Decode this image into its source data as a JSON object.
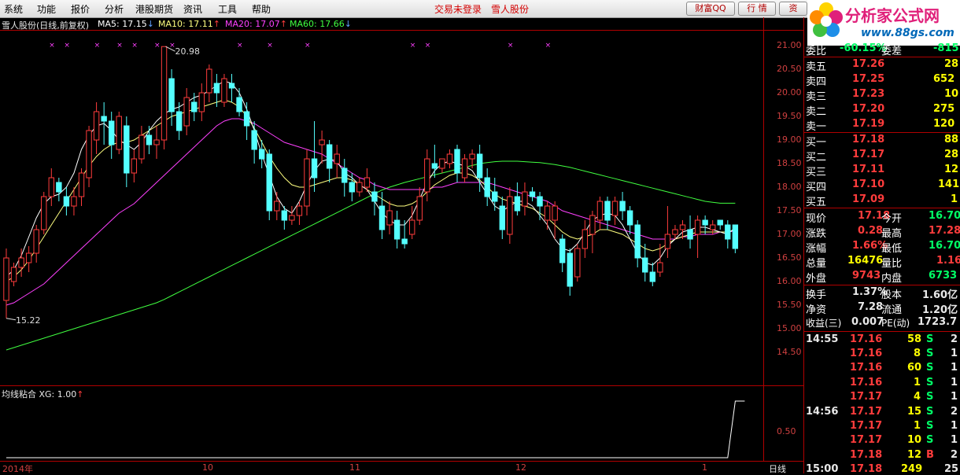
{
  "menu": [
    "系统",
    "功能",
    "报价",
    "分析",
    "港股期货",
    "资讯",
    "工具",
    "帮助"
  ],
  "status_text": "交易未登录",
  "stock_name_title": "雪人股份",
  "toolbar": {
    "caifu": "财富QQ",
    "hangqing": "行 情",
    "zi": "资"
  },
  "logo": {
    "title": "分析家公式网",
    "url": "www.88gs.com"
  },
  "chart": {
    "title": "雪人股份(日线,前复权)",
    "ma": [
      {
        "label": "MA5: 17.15",
        "arrow": "↓",
        "color": "#ffffff"
      },
      {
        "label": "MA10: 17.11",
        "arrow": "↑",
        "color": "#ffff80"
      },
      {
        "label": "MA20: 17.07",
        "arrow": "↑",
        "color": "#ff40ff"
      },
      {
        "label": "MA60: 17.66",
        "arrow": "↓",
        "color": "#40ff40"
      }
    ],
    "price_labels": [
      "21.00",
      "20.50",
      "20.00",
      "19.50",
      "19.00",
      "18.50",
      "18.00",
      "17.50",
      "17.00",
      "16.50",
      "16.00",
      "15.50",
      "15.00",
      "14.50"
    ],
    "high_label": "20.98",
    "low_label": "15.22",
    "indicator": {
      "name": "均线粘合",
      "value_label": "XG: 1.00",
      "arrow": "↑",
      "axis_label": "0.50"
    },
    "date_labels": [
      {
        "text": "2014年"
      },
      {
        "text": "10"
      },
      {
        "text": "11"
      },
      {
        "text": "12"
      },
      {
        "text": "1"
      }
    ],
    "period": "日线",
    "colors": {
      "up": "#ff3c3c",
      "down": "#54ffff",
      "ma5": "#ffffff",
      "ma10": "#ffff80",
      "ma20": "#ff40ff",
      "ma60": "#40ff40",
      "grid": "#b00000"
    }
  },
  "chart_data": {
    "type": "candlestick",
    "ylim": [
      14.5,
      21.0
    ],
    "candles": [
      [
        15.6,
        16.5,
        15.22,
        16.7
      ],
      [
        16.0,
        16.3,
        15.9,
        16.4
      ],
      [
        16.3,
        16.5,
        16.1,
        16.7
      ],
      [
        16.4,
        16.6,
        16.2,
        16.75
      ],
      [
        16.6,
        17.1,
        16.4,
        17.2
      ],
      [
        17.1,
        17.8,
        17.0,
        17.9
      ],
      [
        17.8,
        18.2,
        17.6,
        18.4
      ],
      [
        18.1,
        17.9,
        17.7,
        18.2
      ],
      [
        17.8,
        17.6,
        17.4,
        18.0
      ],
      [
        17.6,
        17.8,
        17.4,
        18.0
      ],
      [
        17.8,
        18.3,
        17.6,
        18.4
      ],
      [
        18.2,
        19.2,
        18.0,
        19.3
      ],
      [
        19.0,
        19.6,
        18.7,
        19.8
      ],
      [
        19.5,
        19.4,
        18.9,
        19.8
      ],
      [
        19.4,
        18.9,
        18.6,
        19.6
      ],
      [
        18.8,
        19.5,
        18.7,
        19.6
      ],
      [
        19.3,
        18.3,
        18.0,
        19.5
      ],
      [
        18.3,
        18.6,
        18.1,
        18.8
      ],
      [
        18.6,
        19.1,
        18.5,
        19.3
      ],
      [
        19.1,
        18.9,
        18.7,
        19.3
      ],
      [
        18.9,
        19.0,
        18.6,
        19.3
      ],
      [
        19.0,
        20.98,
        18.8,
        20.98
      ],
      [
        20.3,
        19.6,
        19.3,
        20.5
      ],
      [
        19.6,
        19.2,
        19.0,
        19.8
      ],
      [
        19.3,
        19.9,
        19.1,
        20.1
      ],
      [
        19.8,
        19.6,
        19.4,
        20.0
      ],
      [
        19.6,
        20.0,
        19.4,
        20.2
      ],
      [
        20.0,
        20.5,
        19.8,
        20.6
      ],
      [
        20.2,
        20.0,
        19.7,
        20.4
      ],
      [
        19.8,
        20.3,
        19.7,
        20.4
      ],
      [
        20.2,
        20.1,
        19.8,
        20.4
      ],
      [
        19.9,
        19.6,
        19.5,
        20.1
      ],
      [
        19.6,
        19.3,
        19.0,
        19.8
      ],
      [
        19.2,
        18.8,
        18.5,
        19.4
      ],
      [
        18.8,
        18.6,
        18.4,
        19.0
      ],
      [
        18.7,
        17.5,
        17.3,
        18.8
      ],
      [
        17.5,
        17.7,
        17.3,
        17.9
      ],
      [
        17.5,
        17.3,
        17.1,
        17.6
      ],
      [
        17.3,
        17.4,
        17.2,
        17.6
      ],
      [
        17.4,
        17.6,
        17.2,
        17.7
      ],
      [
        17.6,
        18.6,
        17.4,
        18.8
      ],
      [
        18.6,
        18.2,
        17.9,
        19.4
      ],
      [
        18.9,
        19.0,
        18.5,
        19.2
      ],
      [
        18.9,
        18.4,
        18.1,
        19.0
      ],
      [
        18.5,
        18.7,
        18.2,
        18.9
      ],
      [
        18.4,
        18.1,
        17.8,
        18.6
      ],
      [
        18.1,
        17.9,
        17.7,
        18.3
      ],
      [
        17.9,
        18.1,
        17.8,
        18.2
      ],
      [
        18.0,
        18.2,
        17.9,
        18.4
      ],
      [
        17.9,
        17.7,
        17.4,
        18.1
      ],
      [
        17.6,
        17.1,
        16.9,
        17.9
      ],
      [
        17.2,
        17.5,
        17.0,
        17.7
      ],
      [
        17.3,
        16.9,
        16.7,
        17.5
      ],
      [
        16.9,
        16.8,
        16.7,
        17.3
      ],
      [
        17.0,
        17.3,
        16.9,
        17.6
      ],
      [
        17.3,
        17.8,
        17.2,
        18.0
      ],
      [
        17.9,
        18.6,
        17.7,
        18.8
      ],
      [
        18.5,
        18.4,
        18.2,
        18.9
      ],
      [
        18.4,
        18.6,
        18.3,
        18.6
      ],
      [
        18.5,
        18.7,
        18.4,
        18.8
      ],
      [
        18.8,
        18.3,
        18.1,
        18.9
      ],
      [
        18.2,
        18.6,
        18.1,
        18.7
      ],
      [
        18.6,
        18.7,
        18.4,
        18.8
      ],
      [
        18.7,
        18.2,
        17.9,
        18.9
      ],
      [
        18.2,
        17.8,
        17.6,
        18.4
      ],
      [
        17.9,
        17.7,
        17.5,
        18.2
      ],
      [
        17.6,
        17.1,
        16.9,
        17.8
      ],
      [
        17.0,
        17.8,
        16.8,
        18.0
      ],
      [
        17.8,
        17.5,
        17.4,
        18.1
      ],
      [
        17.6,
        17.9,
        17.4,
        18.1
      ],
      [
        17.9,
        17.8,
        17.7,
        18.0
      ],
      [
        17.8,
        17.6,
        17.3,
        17.9
      ],
      [
        17.3,
        17.6,
        17.1,
        17.7
      ],
      [
        17.3,
        17.6,
        16.9,
        17.7
      ],
      [
        16.9,
        16.4,
        16.2,
        17.0
      ],
      [
        16.6,
        15.9,
        15.7,
        16.7
      ],
      [
        16.1,
        16.7,
        16.0,
        16.8
      ],
      [
        16.7,
        17.1,
        16.5,
        17.3
      ],
      [
        17.0,
        17.4,
        16.6,
        17.5
      ],
      [
        17.3,
        17.7,
        17.1,
        17.8
      ],
      [
        17.7,
        17.3,
        17.1,
        17.8
      ],
      [
        17.4,
        17.7,
        17.2,
        17.8
      ],
      [
        17.7,
        17.5,
        17.3,
        17.9
      ],
      [
        17.5,
        17.2,
        17.0,
        17.6
      ],
      [
        17.2,
        16.5,
        16.3,
        17.3
      ],
      [
        16.5,
        16.2,
        16.0,
        16.8
      ],
      [
        16.2,
        16.0,
        15.9,
        16.4
      ],
      [
        16.2,
        16.4,
        16.1,
        16.8
      ],
      [
        16.7,
        17.0,
        16.5,
        17.6
      ],
      [
        17.0,
        17.1,
        16.9,
        17.2
      ],
      [
        17.1,
        17.2,
        16.9,
        17.3
      ],
      [
        17.1,
        16.9,
        16.7,
        17.4
      ],
      [
        17.0,
        17.3,
        16.5,
        17.4
      ],
      [
        17.3,
        17.2,
        17.0,
        17.4
      ],
      [
        17.1,
        17.2,
        17.0,
        17.3
      ],
      [
        17.3,
        17.2,
        17.1,
        17.3
      ],
      [
        17.2,
        16.9,
        16.7,
        17.3
      ],
      [
        17.2,
        16.7,
        16.6,
        17.2
      ]
    ],
    "ma_lines": {
      "MA5": [
        16.1,
        16.25,
        16.55,
        16.95,
        17.35,
        17.65,
        17.8,
        17.85,
        18.0,
        18.3,
        18.8,
        19.1,
        19.3,
        19.35,
        19.2,
        19.0,
        18.9,
        18.8,
        18.95,
        19.2,
        19.4,
        19.55,
        19.65,
        19.7,
        19.8,
        19.9,
        19.95,
        20.05,
        20.15,
        20.25,
        20.2,
        20.0,
        19.65,
        19.2,
        18.7,
        18.25,
        17.8,
        17.55,
        17.45,
        17.7,
        18.05,
        18.35,
        18.55,
        18.6,
        18.55,
        18.3,
        18.2,
        18.05,
        17.95,
        17.7,
        17.45,
        17.3,
        17.2,
        17.2,
        17.4,
        17.75,
        18.1,
        18.35,
        18.5,
        18.55,
        18.5,
        18.45,
        18.35,
        18.1,
        17.85,
        17.6,
        17.5,
        17.6,
        17.7,
        17.7,
        17.6,
        17.4,
        17.2,
        16.9,
        16.7,
        16.65,
        16.8,
        17.05,
        17.3,
        17.4,
        17.45,
        17.4,
        17.2,
        16.9,
        16.6,
        16.4,
        16.35,
        16.5,
        16.75,
        16.9,
        17.05,
        17.1,
        17.15,
        17.15,
        17.1,
        17.05,
        17.0,
        17.15
      ],
      "MA10": [
        16.0,
        16.1,
        16.25,
        16.45,
        16.7,
        16.95,
        17.2,
        17.45,
        17.7,
        17.95,
        18.2,
        18.45,
        18.65,
        18.8,
        18.9,
        18.95,
        18.95,
        19.0,
        19.1,
        19.2,
        19.3,
        19.4,
        19.5,
        19.55,
        19.6,
        19.65,
        19.7,
        19.75,
        19.8,
        19.85,
        19.8,
        19.7,
        19.5,
        19.25,
        18.95,
        18.65,
        18.4,
        18.2,
        18.05,
        18.0,
        18.0,
        18.05,
        18.1,
        18.15,
        18.2,
        18.2,
        18.15,
        18.05,
        17.95,
        17.85,
        17.75,
        17.65,
        17.6,
        17.6,
        17.65,
        17.75,
        17.9,
        18.05,
        18.15,
        18.25,
        18.3,
        18.3,
        18.25,
        18.15,
        18.0,
        17.85,
        17.75,
        17.7,
        17.65,
        17.6,
        17.55,
        17.45,
        17.35,
        17.2,
        17.05,
        16.95,
        16.9,
        16.95,
        17.0,
        17.1,
        17.1,
        17.05,
        17.0,
        16.9,
        16.8,
        16.7,
        16.65,
        16.7,
        16.8,
        16.9,
        16.95,
        17.0,
        17.05,
        17.05,
        17.05,
        17.05,
        17.05,
        17.1
      ],
      "MA20": [
        15.5,
        15.55,
        15.65,
        15.75,
        15.85,
        15.95,
        16.1,
        16.25,
        16.4,
        16.55,
        16.7,
        16.85,
        17.0,
        17.15,
        17.3,
        17.45,
        17.55,
        17.65,
        17.8,
        17.95,
        18.1,
        18.25,
        18.4,
        18.55,
        18.7,
        18.85,
        19.0,
        19.15,
        19.3,
        19.4,
        19.45,
        19.45,
        19.4,
        19.35,
        19.25,
        19.15,
        19.05,
        18.95,
        18.9,
        18.85,
        18.8,
        18.75,
        18.7,
        18.6,
        18.5,
        18.4,
        18.3,
        18.2,
        18.15,
        18.05,
        18.0,
        17.95,
        17.95,
        17.95,
        17.95,
        17.95,
        17.95,
        18.0,
        18.0,
        18.05,
        18.1,
        18.1,
        18.1,
        18.1,
        18.1,
        18.05,
        18.0,
        17.95,
        17.9,
        17.85,
        17.8,
        17.75,
        17.7,
        17.6,
        17.5,
        17.45,
        17.4,
        17.35,
        17.3,
        17.25,
        17.2,
        17.15,
        17.1,
        17.05,
        17.0,
        16.95,
        16.9,
        16.9,
        16.9,
        16.9,
        16.95,
        16.95,
        17.0,
        17.0,
        17.0,
        17.05,
        17.05,
        17.07
      ],
      "MA60": [
        14.55,
        14.6,
        14.65,
        14.7,
        14.75,
        14.8,
        14.85,
        14.9,
        14.95,
        15.0,
        15.05,
        15.1,
        15.15,
        15.2,
        15.25,
        15.3,
        15.35,
        15.4,
        15.45,
        15.5,
        15.55,
        15.62,
        15.7,
        15.78,
        15.86,
        15.94,
        16.02,
        16.1,
        16.18,
        16.26,
        16.34,
        16.42,
        16.5,
        16.58,
        16.66,
        16.74,
        16.82,
        16.9,
        16.98,
        17.06,
        17.14,
        17.22,
        17.3,
        17.38,
        17.46,
        17.54,
        17.62,
        17.7,
        17.78,
        17.86,
        17.94,
        18.0,
        18.05,
        18.1,
        18.14,
        18.18,
        18.22,
        18.26,
        18.3,
        18.34,
        18.38,
        18.42,
        18.46,
        18.5,
        18.52,
        18.54,
        18.55,
        18.55,
        18.55,
        18.54,
        18.53,
        18.52,
        18.5,
        18.48,
        18.45,
        18.42,
        18.38,
        18.34,
        18.3,
        18.26,
        18.22,
        18.18,
        18.14,
        18.1,
        18.06,
        18.02,
        17.98,
        17.94,
        17.9,
        17.86,
        17.82,
        17.78,
        17.74,
        17.7,
        17.68,
        17.66,
        17.66,
        17.66
      ]
    },
    "indicator_series": [
      0,
      0,
      0,
      0,
      0,
      0,
      0,
      0,
      0,
      0,
      0,
      0,
      0,
      0,
      0,
      0,
      0,
      0,
      0,
      0,
      0,
      0,
      0,
      0,
      0,
      0,
      0,
      0,
      0,
      0,
      0,
      0,
      0,
      0,
      0,
      0,
      0,
      0,
      0,
      0,
      0,
      0,
      0,
      0,
      0,
      0,
      0,
      0,
      0,
      0,
      0,
      0,
      0,
      0,
      0,
      0,
      0,
      0,
      0,
      0,
      0,
      0,
      0,
      0,
      0,
      0,
      0,
      0,
      0,
      0,
      0,
      0,
      0,
      0,
      0,
      0,
      0,
      0,
      0,
      0,
      0,
      0,
      0,
      0,
      0,
      0,
      0,
      0,
      0,
      0,
      0,
      0,
      0,
      0,
      0,
      0,
      0,
      1
    ]
  },
  "quote": {
    "ratio": {
      "label1": "委比",
      "value1": "-60.15%",
      "label2": "委差",
      "value2": "-815"
    },
    "asks": [
      {
        "label": "卖五",
        "price": "17.26",
        "vol": "28"
      },
      {
        "label": "卖四",
        "price": "17.25",
        "vol": "652"
      },
      {
        "label": "卖三",
        "price": "17.23",
        "vol": "10"
      },
      {
        "label": "卖二",
        "price": "17.20",
        "vol": "275"
      },
      {
        "label": "卖一",
        "price": "17.19",
        "vol": "120"
      }
    ],
    "bids": [
      {
        "label": "买一",
        "price": "17.18",
        "vol": "88"
      },
      {
        "label": "买二",
        "price": "17.17",
        "vol": "28"
      },
      {
        "label": "买三",
        "price": "17.11",
        "vol": "12"
      },
      {
        "label": "买四",
        "price": "17.10",
        "vol": "141"
      },
      {
        "label": "买五",
        "price": "17.09",
        "vol": "1"
      }
    ],
    "stats": [
      {
        "l1": "现价",
        "v1": "17.18",
        "c1": "red",
        "l2": "今开",
        "v2": "16.70",
        "c2": "grn"
      },
      {
        "l1": "涨跌",
        "v1": "0.28",
        "c1": "red",
        "l2": "最高",
        "v2": "17.28",
        "c2": "red"
      },
      {
        "l1": "涨幅",
        "v1": "1.66%",
        "c1": "red",
        "l2": "最低",
        "v2": "16.70",
        "c2": "grn"
      },
      {
        "l1": "总量",
        "v1": "16476",
        "c1": "yel",
        "l2": "量比",
        "v2": "1.16",
        "c2": "red"
      },
      {
        "l1": "外盘",
        "v1": "9743",
        "c1": "red",
        "l2": "内盘",
        "v2": "6733",
        "c2": "grn"
      }
    ],
    "fund": [
      {
        "l1": "换手",
        "v1": "1.37%",
        "l2": "股本",
        "v2": "1.60亿"
      },
      {
        "l1": "净资",
        "v1": "7.28",
        "l2": "流通",
        "v2": "1.20亿"
      },
      {
        "l1": "收益(三)",
        "v1": "0.007",
        "l2": "PE(动)",
        "v2": "1723.7"
      }
    ],
    "ticks": [
      {
        "time": "14:55",
        "price": "17.16",
        "vol": "58",
        "bs": "S",
        "n": "2"
      },
      {
        "time": "",
        "price": "17.16",
        "vol": "8",
        "bs": "S",
        "n": "1"
      },
      {
        "time": "",
        "price": "17.16",
        "vol": "60",
        "bs": "S",
        "n": "1"
      },
      {
        "time": "",
        "price": "17.16",
        "vol": "1",
        "bs": "S",
        "n": "1"
      },
      {
        "time": "",
        "price": "17.17",
        "vol": "4",
        "bs": "S",
        "n": "1"
      },
      {
        "time": "14:56",
        "price": "17.17",
        "vol": "15",
        "bs": "S",
        "n": "2"
      },
      {
        "time": "",
        "price": "17.17",
        "vol": "1",
        "bs": "S",
        "n": "1"
      },
      {
        "time": "",
        "price": "17.17",
        "vol": "10",
        "bs": "S",
        "n": "1"
      },
      {
        "time": "",
        "price": "17.18",
        "vol": "12",
        "bs": "B",
        "n": "2"
      },
      {
        "time": "15:00",
        "price": "17.18",
        "vol": "249",
        "bs": "",
        "n": "25"
      }
    ]
  }
}
